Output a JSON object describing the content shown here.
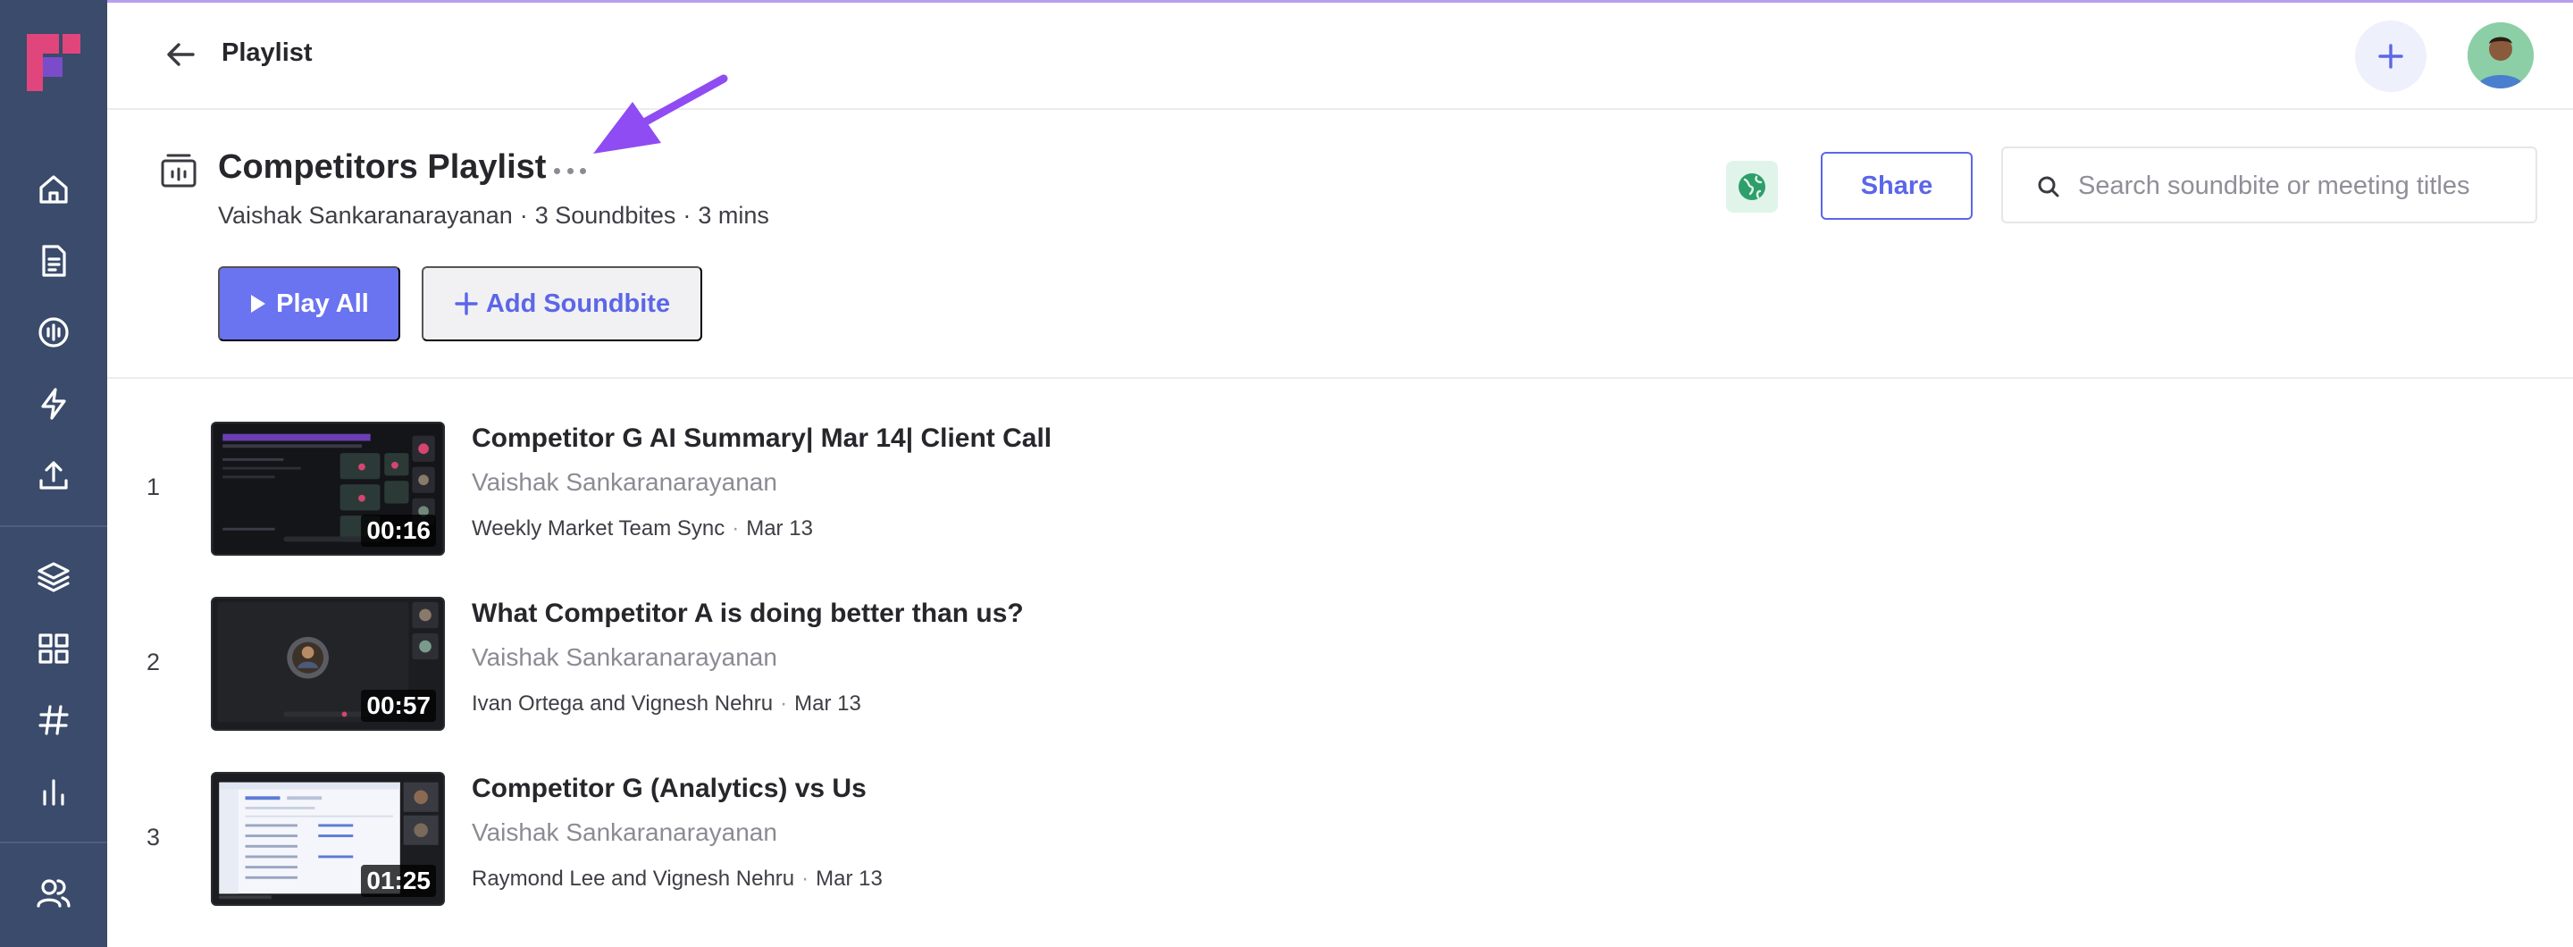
{
  "header": {
    "title": "Playlist"
  },
  "playlist": {
    "title": "Competitors Playlist",
    "owner": "Vaishak Sankaranarayanan",
    "soundbite_count": "3 Soundbites",
    "duration": "3 mins",
    "play_all_label": "Play All",
    "add_soundbite_label": "Add Soundbite",
    "share_label": "Share",
    "search_placeholder": "Search soundbite or meeting titles"
  },
  "items": [
    {
      "number": "1",
      "title": "Competitor G AI Summary| Mar 14| Client Call",
      "author": "Vaishak Sankaranarayanan",
      "meeting": "Weekly Market Team Sync",
      "date": "Mar 13",
      "duration": "00:16"
    },
    {
      "number": "2",
      "title": "What Competitor A is doing better than us?",
      "author": "Vaishak Sankaranarayanan",
      "meeting": "Ivan Ortega and Vignesh Nehru",
      "date": "Mar 13",
      "duration": "00:57"
    },
    {
      "number": "3",
      "title": "Competitor G (Analytics) vs Us",
      "author": "Vaishak Sankaranarayanan",
      "meeting": "Raymond Lee and Vignesh Nehru",
      "date": "Mar 13",
      "duration": "01:25"
    }
  ],
  "colors": {
    "sidebar": "#3a4b6b",
    "accent": "#6a73f0",
    "annotation_arrow": "#8f4cf2"
  },
  "sidebar": {
    "icons": [
      "home-icon",
      "notes-icon",
      "soundbite-icon",
      "lightning-icon",
      "upload-icon",
      "layers-icon",
      "apps-grid-icon",
      "hashtag-icon",
      "analytics-icon",
      "team-icon"
    ]
  }
}
